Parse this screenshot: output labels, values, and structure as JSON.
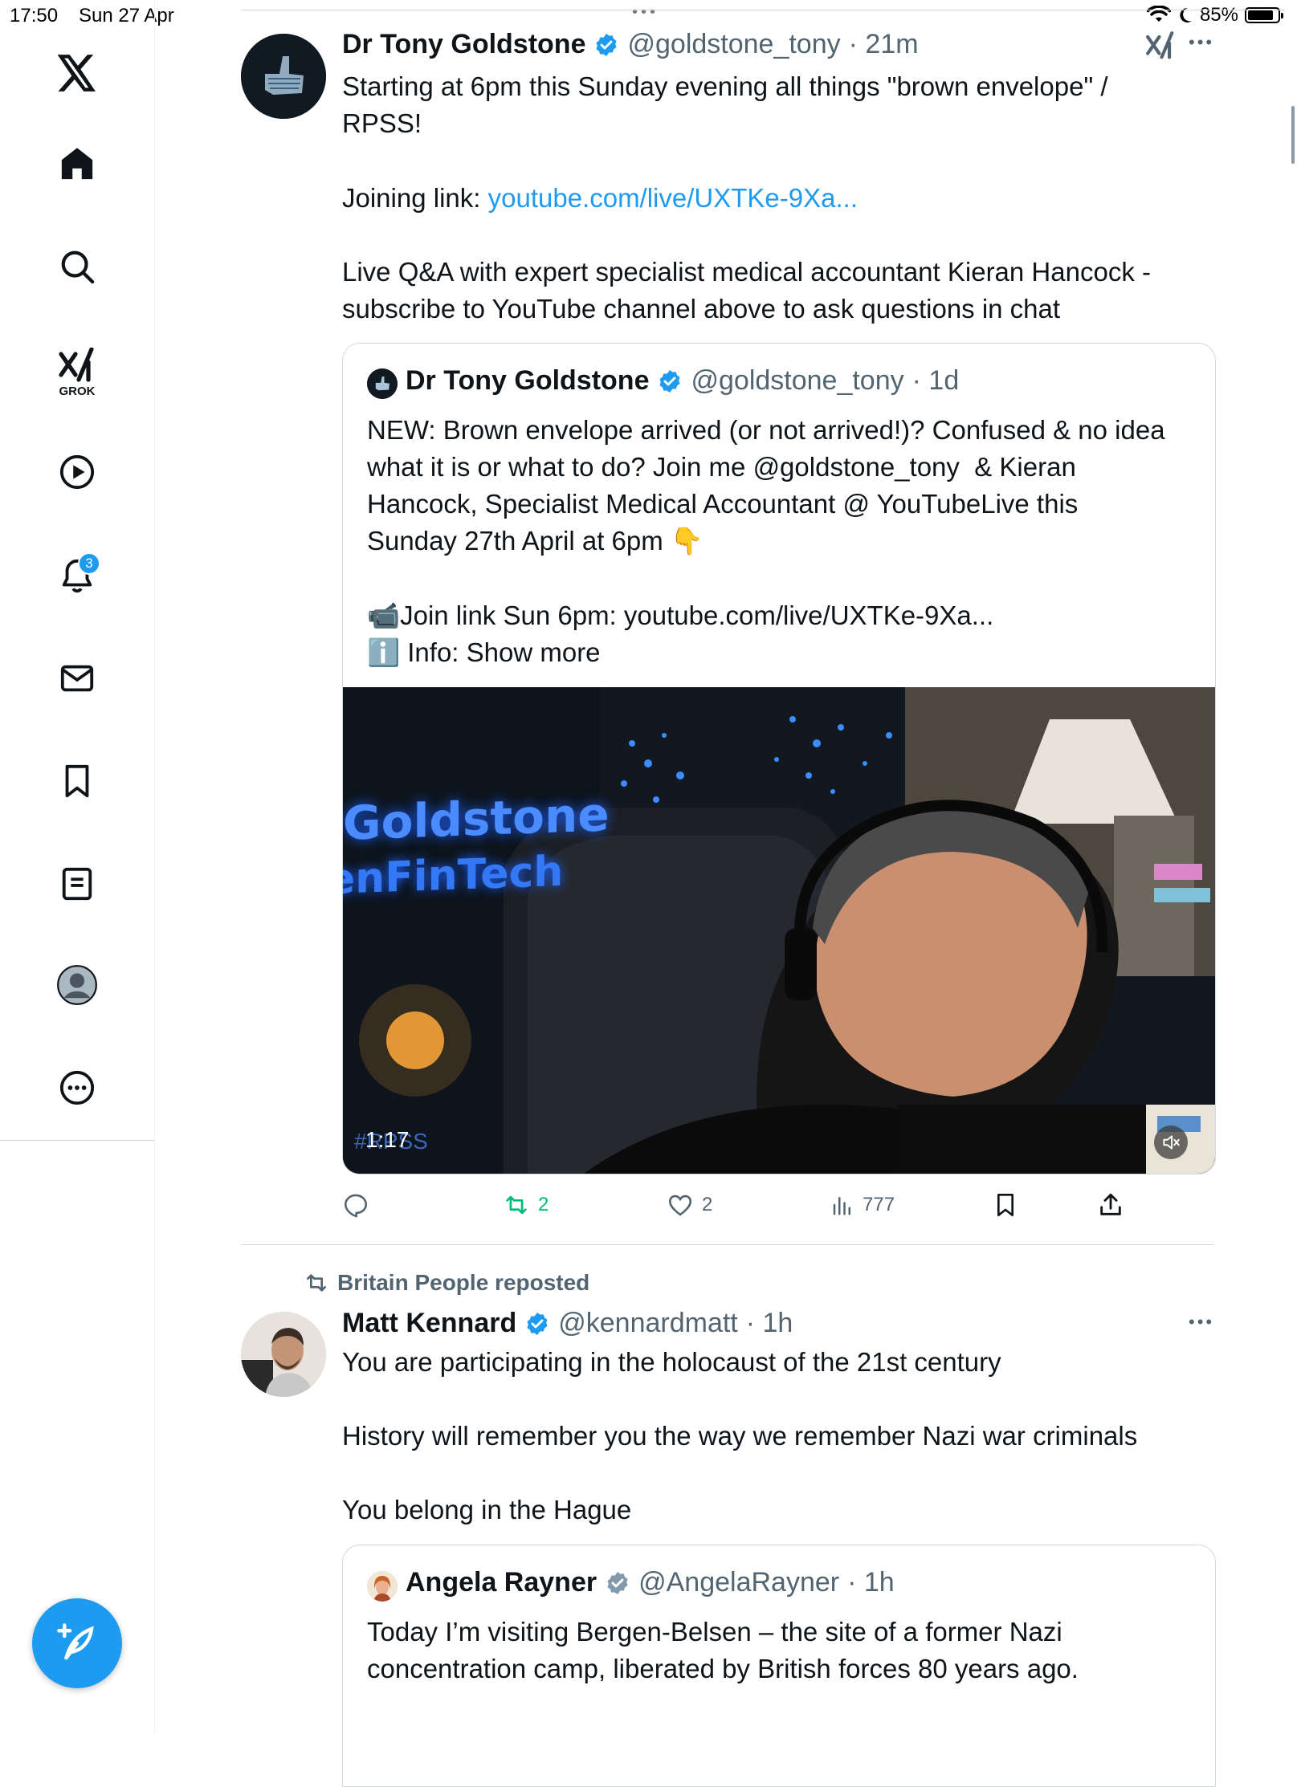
{
  "status_bar": {
    "time": "17:50",
    "date": "Sun 27 Apr",
    "battery": "85%",
    "battery_level": 0.85
  },
  "sidebar": {
    "grok_label": "GROK",
    "notifications_count": "3"
  },
  "post1": {
    "author": "Dr Tony Goldstone",
    "handle": "@goldstone_tony",
    "time": "· 21m",
    "text_a": "Starting at 6pm this Sunday evening all things \"brown envelope\" /\nRPSS!",
    "link_prefix": "Joining link: ",
    "link": "youtube.com/live/UXTKe-9Xa...",
    "text_b": "Live Q&A with expert specialist medical accountant Kieran Hancock -\nsubscribe to YouTube channel above to ask questions in chat",
    "quote": {
      "author": "Dr Tony Goldstone",
      "handle": "@goldstone_tony",
      "time": "· 1d",
      "text": "NEW: Brown envelope arrived (or not arrived!)? Confused & no idea\nwhat it is or what to do? Join me @goldstone_tony  & Kieran\nHancock, Specialist Medical Accountant @ YouTubeLive this\nSunday 27th April at 6pm 👇",
      "join_line": "📹Join link Sun 6pm: youtube.com/live/UXTKe-9Xa...",
      "info_line": "ℹ️ Info: Show more",
      "video": {
        "sign_line1": "Goldstone",
        "sign_line2": "enFinTech",
        "watermark": "#RPSS",
        "duration": "1:17"
      }
    },
    "actions": {
      "retweets": "2",
      "likes": "2",
      "views": "777"
    }
  },
  "post2": {
    "repost_label": "Britain People reposted",
    "author": "Matt Kennard",
    "handle": "@kennardmatt",
    "time": "· 1h",
    "text": "You are participating in the holocaust of the 21st century\n\nHistory will remember you the way we remember Nazi war criminals\n\nYou belong in the Hague",
    "quote": {
      "author": "Angela Rayner",
      "handle": "@AngelaRayner",
      "time": "· 1h",
      "text": "Today I’m visiting Bergen-Belsen – the site of a former Nazi\nconcentration camp, liberated by British forces 80 years ago."
    }
  },
  "colors": {
    "accent": "#1d9bf0",
    "retweet": "#00ba7c",
    "text": "#0f1419",
    "muted": "#536471"
  }
}
